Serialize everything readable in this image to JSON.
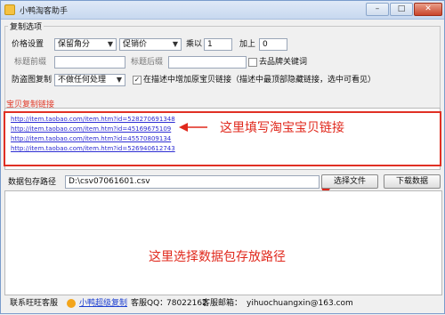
{
  "window": {
    "title": "小鸭淘客助手",
    "buttons": {
      "min": "–",
      "max": "□",
      "close": "✕"
    }
  },
  "copy_options": {
    "group_title": "复制选项",
    "price_label": "价格设置",
    "price_rounding": {
      "value": "保留角分"
    },
    "price_basis": {
      "value": "促销价"
    },
    "multiply_label": "乘以",
    "multiply_value": "1",
    "add_label": "加上",
    "add_value": "0",
    "title_prefix_label": "标题前缀",
    "title_prefix_value": "",
    "title_suffix_label": "标题后缀",
    "title_suffix_value": "",
    "remove_brand_label": "去品牌关键词",
    "remove_brand_checked": false,
    "anti_dup_label": "防盗图复制",
    "anti_dup_select": {
      "value": "不做任何处理"
    },
    "add_link_label": "在描述中增加原宝贝链接（描述中最顶部隐藏链接，选中可看见）",
    "add_link_checked": true
  },
  "links": {
    "section_title": "宝贝复制链接",
    "items": [
      "http://item.taobao.com/item.htm?id=528270691348",
      "http://item.taobao.com/item.htm?id=45169675109",
      "http://item.taobao.com/item.htm?id=45570809134",
      "http://item.taobao.com/item.htm?id=526940612743"
    ],
    "annotation": "这里填写淘宝宝贝链接"
  },
  "path": {
    "label": "数据包存路径",
    "value": "D:\\csv07061601.csv",
    "select_file_button": "选择文件",
    "download_button": "下载数据",
    "annotation": "这里选择数据包存放路径"
  },
  "footer": {
    "contact_label": "联系旺旺客服",
    "advanced_link": "小鸭超级复制",
    "qq_label": "客服QQ：",
    "qq_value": "78022162",
    "email_label": "客服邮箱：",
    "email_value": "yihuochuangxin@163.com"
  },
  "colors": {
    "annotation": "#e0281c",
    "link": "#2d2dd3",
    "section_title": "#e23c2a"
  }
}
